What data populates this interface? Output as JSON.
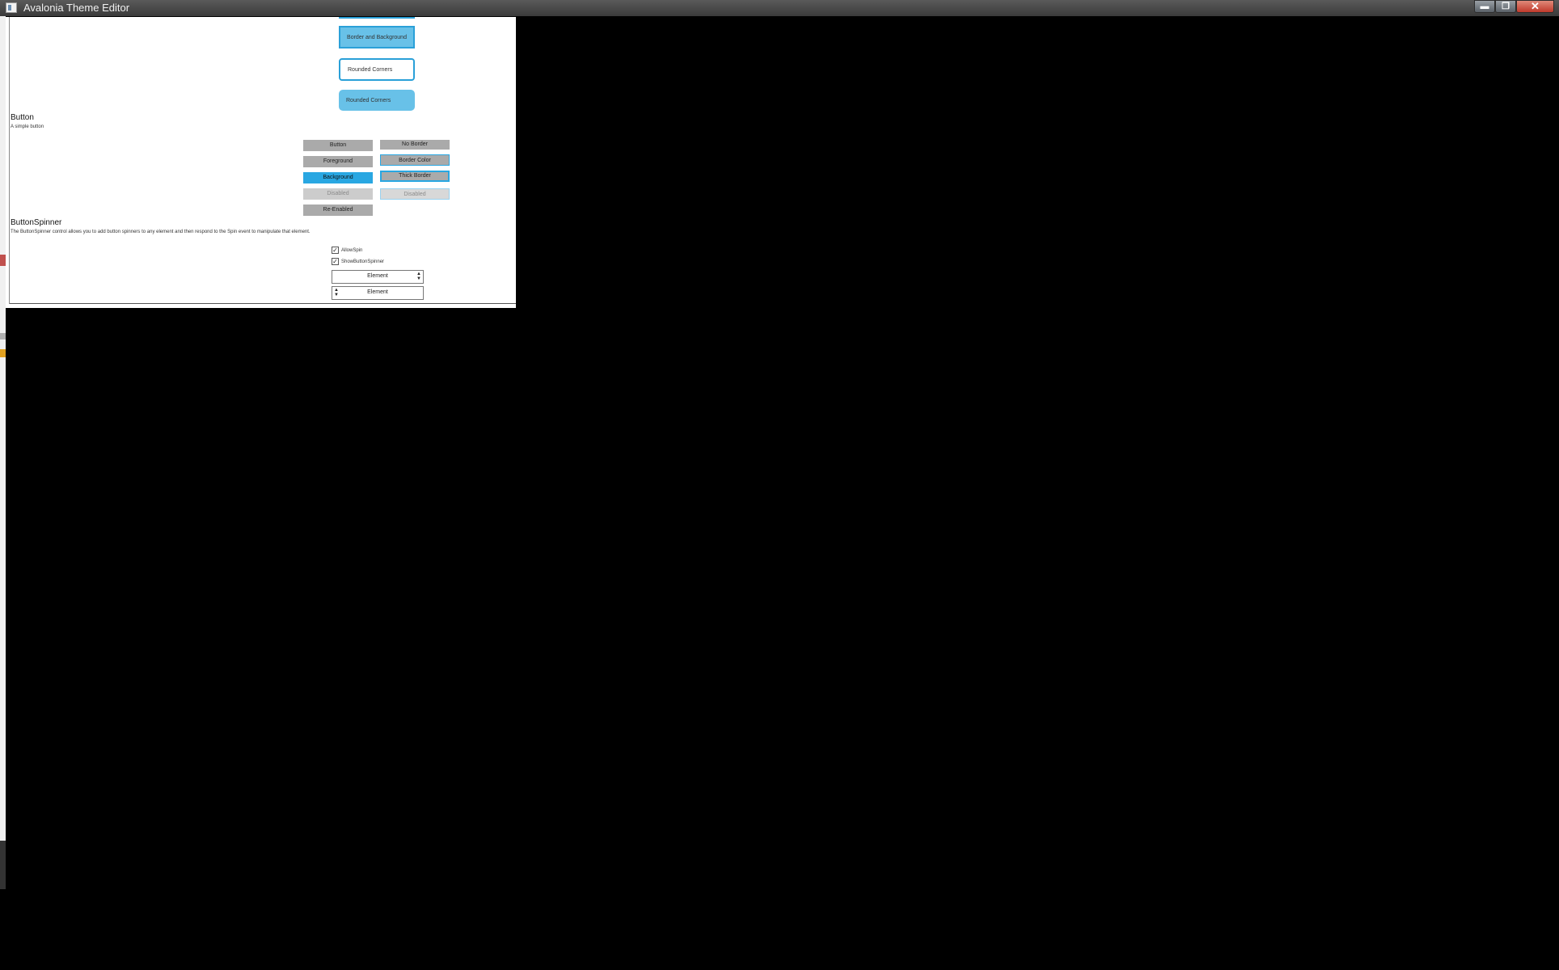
{
  "window": {
    "title": "Avalonia Theme Editor",
    "controls": {
      "minimize": "▬",
      "maximize": "❐",
      "close": "✕"
    }
  },
  "border_samples": {
    "items": [
      "Border and Background",
      "Rounded Corners",
      "Rounded Corners"
    ]
  },
  "button_section": {
    "title": "Button",
    "description": "A simple button",
    "col1": [
      "Button",
      "Foreground",
      "Background",
      "Disabled",
      "Re-Enabled"
    ],
    "col2": [
      "No Border",
      "Border Color",
      "Thick Border",
      "Disabled"
    ]
  },
  "spinner_section": {
    "title": "ButtonSpinner",
    "description": "The ButtonSpinner control allows you to add button spinners to any element and then respond to the Spin event to manipulate that element.",
    "allow_spin": {
      "label": "AllowSpin",
      "checked": true
    },
    "show_spinner": {
      "label": "ShowButtonSpinner",
      "checked": true
    },
    "spinner1": {
      "text": "Element"
    },
    "spinner2": {
      "text": "Element"
    }
  },
  "colors": {
    "accent": "#29a7e2",
    "light_accent": "#68c1e8",
    "button_gray": "#aaaaaa"
  }
}
